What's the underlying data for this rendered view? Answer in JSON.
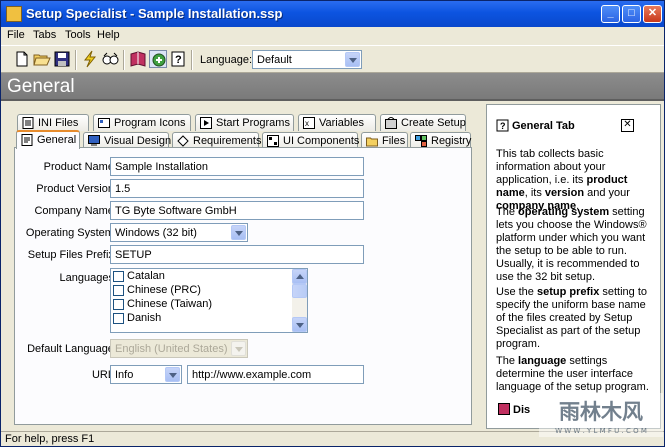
{
  "window": {
    "title": "Setup Specialist - Sample Installation.ssp"
  },
  "menu": [
    "File",
    "Tabs",
    "Tools",
    "Help"
  ],
  "toolbar": {
    "language_label": "Language:",
    "language_value": "Default"
  },
  "header": {
    "title": "General"
  },
  "tabs_back": [
    "INI Files",
    "Program Icons",
    "Start Programs",
    "Variables",
    "Create Setup"
  ],
  "tabs_front": [
    "General",
    "Visual Design",
    "Requirements",
    "UI Components",
    "Files",
    "Registry"
  ],
  "form": {
    "product_name_label": "Product Name:",
    "product_name": "Sample Installation",
    "product_version_label": "Product Version:",
    "product_version": "1.5",
    "company_name_label": "Company Name:",
    "company_name": "TG Byte Software GmbH",
    "os_label": "Operating System:",
    "os_value": "Windows (32 bit)",
    "prefix_label": "Setup Files Prefix:",
    "prefix_value": "SETUP",
    "languages_label": "Languages:",
    "languages": [
      "Catalan",
      "Chinese (PRC)",
      "Chinese (Taiwan)",
      "Danish"
    ],
    "default_language_label": "Default Language:",
    "default_language": "English (United States)",
    "url_label": "URL:",
    "url_type": "Info",
    "url_value": "http://www.example.com"
  },
  "help": {
    "title": "General Tab",
    "p1a": "This tab collects basic information about your application, i.e. its ",
    "p1b": "product name",
    "p1c": ", its ",
    "p1d": "version",
    "p1e": " and your ",
    "p1f": "company name",
    "p1g": ".",
    "p2a": "The ",
    "p2b": "operating system",
    "p2c": " setting lets you choose the Windows® platform under which you want the setup to be able to run. Usually, it is recommended to use the 32 bit setup.",
    "p3a": "Use the ",
    "p3b": "setup prefix",
    "p3c": " setting to specify the uniform base name of the files created by Setup Specialist as part of the setup program.",
    "p4a": "The ",
    "p4b": "language",
    "p4c": " settings determine the user interface language of the setup program.",
    "display": "Dis"
  },
  "status": {
    "text": "For help, press F1"
  },
  "watermark": {
    "line1": "雨林木风",
    "line2": "W W W . Y L M F U . C O M"
  }
}
